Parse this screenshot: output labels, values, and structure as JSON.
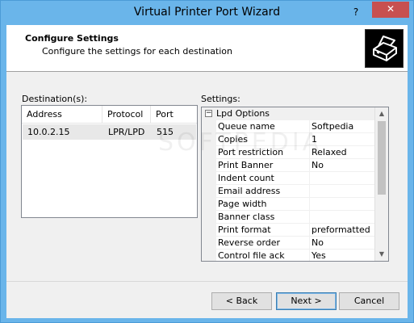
{
  "window": {
    "title": "Virtual Printer Port Wizard",
    "help_glyph": "?",
    "close_glyph": "✕"
  },
  "header": {
    "title": "Configure Settings",
    "subtitle": "Configure the settings for each destination",
    "icon": "printer-icon"
  },
  "destinations": {
    "label": "Destination(s):",
    "columns": [
      "Address",
      "Protocol",
      "Port"
    ],
    "rows": [
      {
        "address": "10.0.2.15",
        "protocol": "LPR/LPD",
        "port": "515"
      }
    ]
  },
  "settings": {
    "label": "Settings:",
    "group": {
      "expander": "⊟",
      "name": "Lpd Options"
    },
    "rows": [
      {
        "name": "Queue name",
        "value": "Softpedia"
      },
      {
        "name": "Copies",
        "value": "1"
      },
      {
        "name": "Port restriction",
        "value": "Relaxed"
      },
      {
        "name": "Print Banner",
        "value": "No"
      },
      {
        "name": "Indent count",
        "value": ""
      },
      {
        "name": "Email address",
        "value": ""
      },
      {
        "name": "Page width",
        "value": ""
      },
      {
        "name": "Banner class",
        "value": ""
      },
      {
        "name": "Print format",
        "value": "preformatted"
      },
      {
        "name": "Reverse order",
        "value": "No"
      },
      {
        "name": "Control file ack",
        "value": "Yes"
      }
    ]
  },
  "watermark": "SOFTPEDIA",
  "buttons": {
    "back": "< Back",
    "next": "Next >",
    "cancel": "Cancel"
  },
  "colors": {
    "titlebar": "#6ab5ea",
    "close_button": "#c75050",
    "selection_row": "#e8e8e8"
  }
}
